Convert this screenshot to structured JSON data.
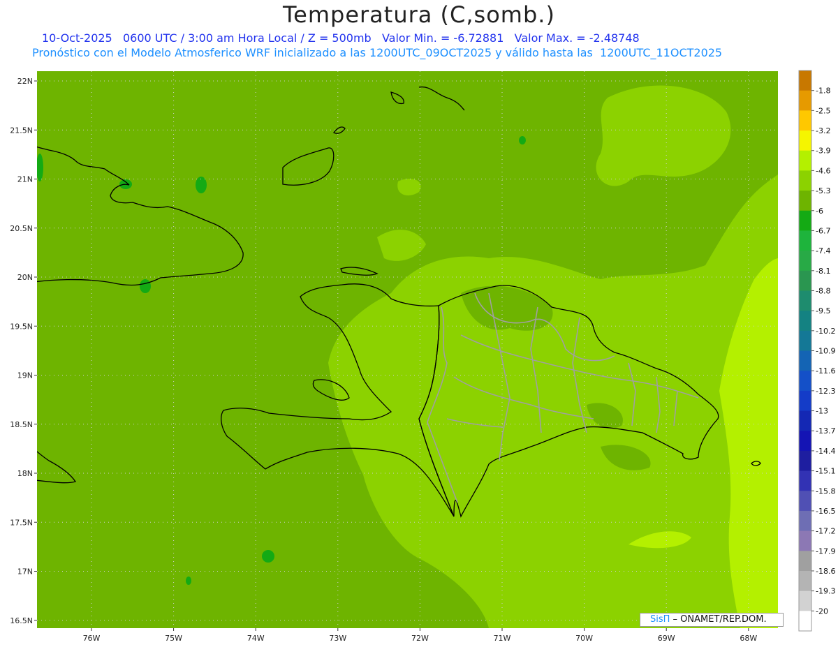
{
  "title": "Temperatura (C,somb.)",
  "subtitle_line1": "10-Oct-2025   0600 UTC / 3:00 am Hora Local / Z = 500mb   Valor Min. = -6.72881   Valor Max. = -2.48748",
  "subtitle_line2": "Pronóstico con el Modelo Atmosferico WRF inicializado a las 1200UTC_09OCT2025 y válido hasta las  1200UTC_11OCT2025",
  "lat_labels": [
    "22N",
    "21.5N",
    "21N",
    "20.5N",
    "20N",
    "19.5N",
    "19N",
    "18.5N",
    "18N",
    "17.5N",
    "17N",
    "16.5N"
  ],
  "lon_labels": [
    "76W",
    "75W",
    "74W",
    "73W",
    "72W",
    "71W",
    "70W",
    "69W",
    "68W"
  ],
  "colorbar": {
    "labels": [
      "-1.8",
      "-2.5",
      "-3.2",
      "-3.9",
      "-4.6",
      "-5.3",
      "-6",
      "-6.7",
      "-7.4",
      "-8.1",
      "-8.8",
      "-9.5",
      "-10.2",
      "-10.9",
      "-11.6",
      "-12.3",
      "-13",
      "-13.7",
      "-14.4",
      "-15.1",
      "-15.8",
      "-16.5",
      "-17.2",
      "-17.9",
      "-18.6",
      "-19.3",
      "-20"
    ],
    "colors": [
      "#c87800",
      "#e69a00",
      "#ffc800",
      "#f5f500",
      "#b4f000",
      "#8cd200",
      "#6eb400",
      "#14aa14",
      "#1eb43c",
      "#28aa46",
      "#2a9650",
      "#1e8c6e",
      "#148282",
      "#147896",
      "#1464b4",
      "#1450c8",
      "#143cc8",
      "#1428b4",
      "#1414b4",
      "#1e1ea0",
      "#3232b4",
      "#5050b4",
      "#6e6eb4",
      "#8c78b4",
      "#a0a0a0",
      "#b4b4b4",
      "#d2d2d2",
      "#ffffff"
    ]
  },
  "credit": {
    "logo": "SisΠ",
    "text": " – ONAMET/REP.DOM."
  },
  "field_colors": {
    "base": "#6eb400",
    "mid": "#8cd200",
    "high": "#b4f000",
    "low": "#14aa14"
  }
}
